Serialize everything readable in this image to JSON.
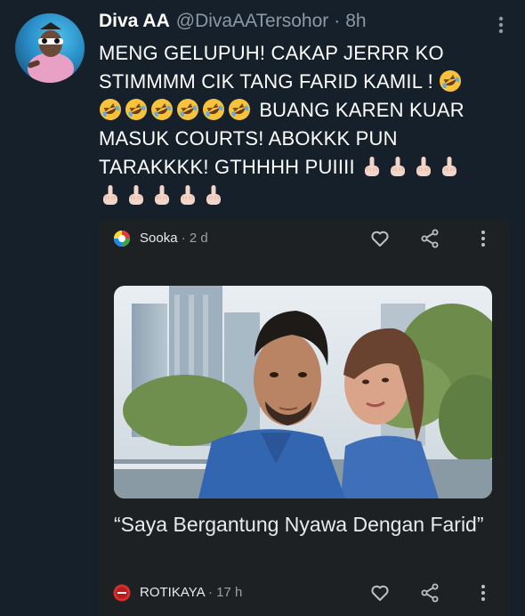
{
  "tweet": {
    "display_name": "Diva AA",
    "handle": "@DivaAATersohor",
    "separator": "·",
    "time": "8h",
    "text_lines": [
      "MENG GELUPUH! CAKAP JERRR KO",
      "STIMMMM CIK TANG FARID KAMIL !",
      "BUANG KAREN KUAR",
      "MASUK COURTS! ABOKKK PUN",
      "TARAKKKK! GTHHHH PUIIII"
    ],
    "icons": {
      "more": "more-vertical-icon",
      "laugh_emoji": "rolling-laughing-emoji",
      "finger_emoji": "middle-finger-emoji"
    }
  },
  "card": {
    "top_source": {
      "name": "Sooka",
      "meta": "· 2 d"
    },
    "headline": "“Saya Bergantung Nyawa Dengan Farid”",
    "bottom_source": {
      "name": "ROTIKAYA",
      "meta": "· 17 h"
    },
    "icons": [
      "heart-icon",
      "share-icon",
      "more-vertical-icon"
    ]
  },
  "colors": {
    "background": "#15202b",
    "card": "#1e2124",
    "muted": "#8b98a5"
  }
}
